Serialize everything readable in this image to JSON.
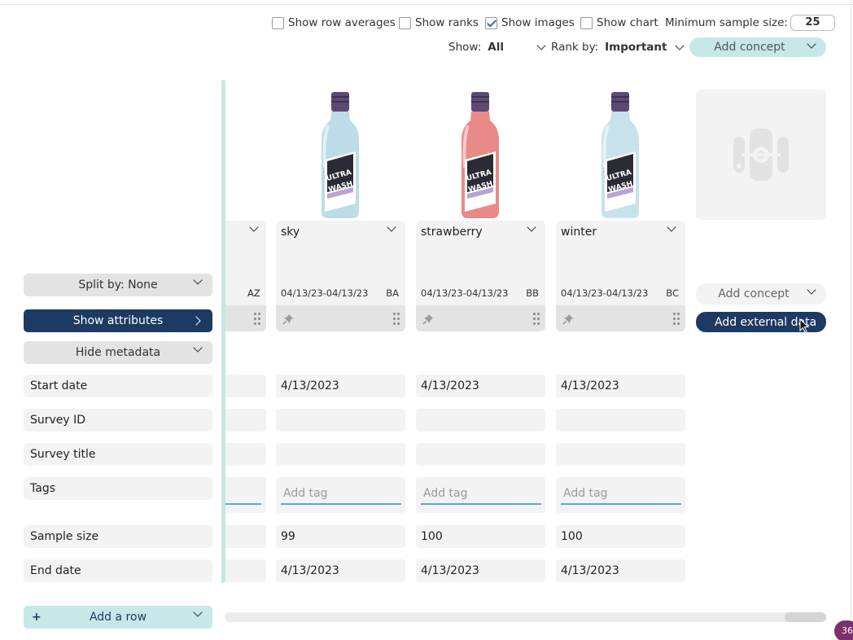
{
  "options": {
    "row_averages": {
      "label": "Show row averages",
      "checked": false
    },
    "ranks": {
      "label": "Show ranks",
      "checked": false
    },
    "images": {
      "label": "Show images",
      "checked": true
    },
    "chart": {
      "label": "Show chart",
      "checked": false
    },
    "min_sample": {
      "label": "Minimum sample size:",
      "value": "25"
    }
  },
  "filters": {
    "show_label": "Show:",
    "show_value": "All",
    "rank_label": "Rank by:",
    "rank_value": "Important",
    "add_concept": "Add concept"
  },
  "left": {
    "split_by": "Split by: None",
    "show_attributes": "Show attributes",
    "hide_metadata": "Hide metadata",
    "rows": [
      "Start date",
      "Survey ID",
      "Survey title",
      "Tags",
      "Sample size",
      "End date"
    ],
    "add_row": "Add a row",
    "add_row_plus": "+"
  },
  "partial": {
    "code": "AZ"
  },
  "concepts": [
    {
      "name": "sky",
      "date_range": "04/13/23-04/13/23",
      "code": "BA",
      "start_date": "4/13/2023",
      "survey_id": "",
      "survey_title": "",
      "tag_placeholder": "Add tag",
      "sample_size": "99",
      "end_date": "4/13/2023",
      "color": "#bcdde8"
    },
    {
      "name": "strawberry",
      "date_range": "04/13/23-04/13/23",
      "code": "BB",
      "start_date": "4/13/2023",
      "survey_id": "",
      "survey_title": "",
      "tag_placeholder": "Add tag",
      "sample_size": "100",
      "end_date": "4/13/2023",
      "color": "#e98a88"
    },
    {
      "name": "winter",
      "date_range": "04/13/23-04/13/23",
      "code": "BC",
      "start_date": "4/13/2023",
      "survey_id": "",
      "survey_title": "",
      "tag_placeholder": "Add tag",
      "sample_size": "100",
      "end_date": "4/13/2023",
      "color": "#c7e2ea"
    }
  ],
  "bottle_label": {
    "line1": "ULTRA",
    "line2": "WASH"
  },
  "placeholder_col": {
    "add_concept": "Add concept",
    "add_external": "Add external data"
  },
  "badge": "36",
  "colors": {
    "navy": "#1d3a63",
    "teal_light": "#c7e8e8",
    "accent_underline": "#5aa9d6"
  }
}
